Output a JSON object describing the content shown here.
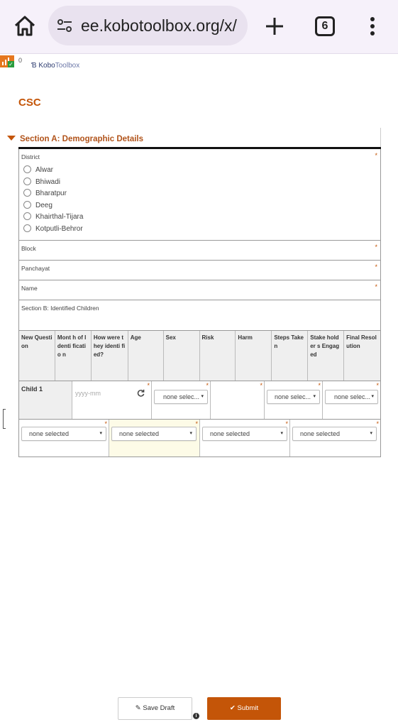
{
  "browser": {
    "url": "ee.kobotoolbox.org/x/",
    "tab_count": "6"
  },
  "app": {
    "notification_count": "0",
    "logo_kobo": "Kobo",
    "logo_toolbox": "Toolbox"
  },
  "form": {
    "title": "CSC",
    "section_a": "Section A: Demographic Details",
    "district": {
      "label": "District",
      "options": [
        "Alwar",
        "Bhiwadi",
        "Bharatpur",
        "Deeg",
        "Khairthal-Tijara",
        "Kotputli-Behror"
      ]
    },
    "block_label": "Block",
    "panchayat_label": "Panchayat",
    "name_label": "Name",
    "section_b": "Section B: Identified Children",
    "required_marker": "*",
    "columns": [
      "New Questi on",
      "Mont h of Identi ficatio n",
      "How were they identi fied?",
      "Age",
      "Sex",
      "Risk",
      "Harm",
      "Steps Taken",
      "Stake holder s Engag ed",
      "Final Resol ution"
    ],
    "row_label": "Child 1",
    "date_placeholder": "yyyy-mm",
    "select_placeholder_short": "none selec...",
    "select_placeholder": "none selected"
  },
  "actions": {
    "save_draft": "Save Draft",
    "submit": "Submit"
  },
  "colors": {
    "accent": "#c45508",
    "highlight": "#fdfbe7"
  }
}
